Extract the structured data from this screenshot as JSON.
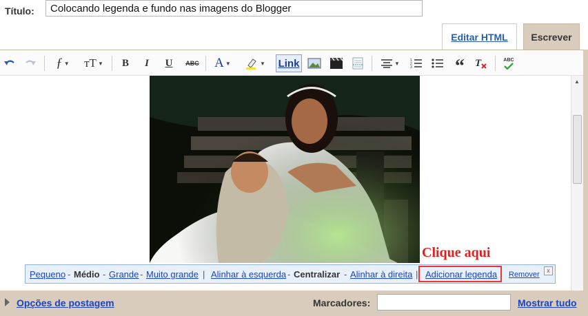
{
  "title": {
    "label": "Título:",
    "value": "Colocando legenda e fundo nas imagens do Blogger"
  },
  "tabs": {
    "edit_html": "Editar HTML",
    "write": "Escrever"
  },
  "toolbar": {
    "font_glyph": "ƒ",
    "size_glyph": "тT",
    "bold": "B",
    "italic": "I",
    "underline": "U",
    "strike": "ABC",
    "text_color": "A",
    "link": "Link",
    "spellcheck_glyph": "ABC"
  },
  "image_bar": {
    "small": "Pequeno",
    "medium": "Médio",
    "large": "Grande",
    "xlarge": "Muito grande",
    "align_left": "Alinhar à esquerda",
    "center": "Centralizar",
    "align_right": "Alinhar à direita",
    "add_caption": "Adicionar legenda",
    "remove": "Remover",
    "close": "x"
  },
  "annotation": "Clique aqui",
  "bottom": {
    "post_options": "Opções de postagem",
    "labels": "Marcadores:",
    "labels_value": "",
    "show_all": "Mostrar tudo"
  }
}
